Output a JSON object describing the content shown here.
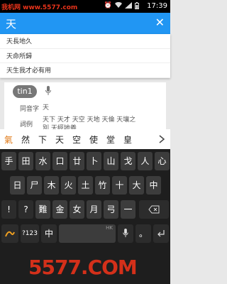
{
  "status_bar": {
    "watermark": "我机网 www.5577.com",
    "time": "17:39"
  },
  "app_bar": {
    "query": "天",
    "clear_symbol": "✕"
  },
  "suggestions": [
    "天長地久",
    "天命所歸",
    "天生我才必有用"
  ],
  "result": {
    "pronunciation": "tin1",
    "homophone_label": "同音字",
    "homophone_value": "天",
    "words_label": "詞例",
    "words_value_line1": "天下 天才 天空 天地 天倫 天壤之",
    "words_value_line2": "別 天經地義"
  },
  "candidates": [
    "氣",
    "然",
    "下",
    "天",
    "空",
    "使",
    "堂",
    "皇"
  ],
  "keyboard": {
    "row1": [
      "手",
      "田",
      "水",
      "口",
      "廿",
      "卜",
      "山",
      "戈",
      "人",
      "心"
    ],
    "row2": [
      "日",
      "尸",
      "木",
      "火",
      "土",
      "竹",
      "十",
      "大",
      "中"
    ],
    "row3": [
      "!",
      "?",
      "難",
      "金",
      "女",
      "月",
      "弓",
      "一"
    ],
    "row4": {
      "symbols": "?123",
      "lang": "中",
      "sub": "中",
      "space": "",
      "dot": "。",
      "hk": "HK"
    }
  },
  "colors": {
    "app_bar": "#2196f3",
    "keyboard": "#1e1e1e",
    "key": "#3c3c3c",
    "watermark": "#e8331a"
  },
  "watermark_bottom": "5577.COM"
}
